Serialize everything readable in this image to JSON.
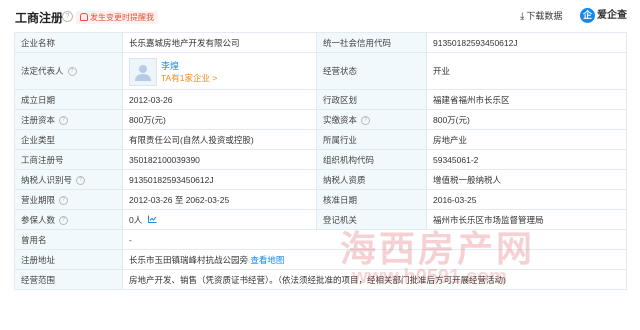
{
  "header": {
    "title": "工商注册",
    "alert": "发生变更时提醒我",
    "download": "下载数据",
    "qcc": "爱企查",
    "qcc_logo": "企"
  },
  "rows": [
    {
      "l1": "企业名称",
      "v1": "长乐嘉城房地产开发有限公司",
      "l2": "统一社会信用代码",
      "v2": "91350182593450612J"
    },
    {
      "l1": "法定代表人",
      "l2": "经营状态",
      "v2": "开业"
    },
    {
      "l1": "成立日期",
      "v1": "2012-03-26",
      "l2": "行政区划",
      "v2": "福建省福州市长乐区"
    },
    {
      "l1": "注册资本",
      "v1": "800万(元)",
      "l2": "实缴资本",
      "v2": "800万(元)"
    },
    {
      "l1": "企业类型",
      "v1": "有限责任公司(自然人投资或控股)",
      "l2": "所属行业",
      "v2": "房地产业"
    },
    {
      "l1": "工商注册号",
      "v1": "350182100039390",
      "l2": "组织机构代码",
      "v2": "59345061-2"
    },
    {
      "l1": "纳税人识别号",
      "v1": "91350182593450612J",
      "l2": "纳税人资质",
      "v2": "增值税一般纳税人"
    },
    {
      "l1": "营业期限",
      "v1": "2012-03-26 至 2062-03-25",
      "l2": "核准日期",
      "v2": "2016-03-25"
    },
    {
      "l1": "参保人数",
      "v1": "0人",
      "l2": "登记机关",
      "v2": "福州市长乐区市场监督管理局"
    },
    {
      "l1": "曾用名",
      "v1": "-"
    },
    {
      "l1": "注册地址",
      "v1": "长乐市玉田镇瑞峰村抗战公园旁",
      "link": "查看地图"
    },
    {
      "l1": "经营范围",
      "v1": "房地产开发、销售（凭资质证书经营）。（依法须经批准的项目，经相关部门批准后方可开展经营活动)"
    }
  ],
  "legal_rep": {
    "name": "李煌",
    "companies": "TA有1家企业 >"
  },
  "watermark": {
    "title": "海西房产网",
    "url": "www.h0591.com"
  },
  "colors": {
    "accent": "#128bed",
    "label_bg": "#f2f9fc",
    "alert": "#e4523b",
    "orange": "#f08a1b"
  },
  "icons": [
    "help-icon",
    "bell-icon",
    "download-icon",
    "qcc-logo-icon",
    "avatar-icon",
    "trend-chart-icon"
  ]
}
